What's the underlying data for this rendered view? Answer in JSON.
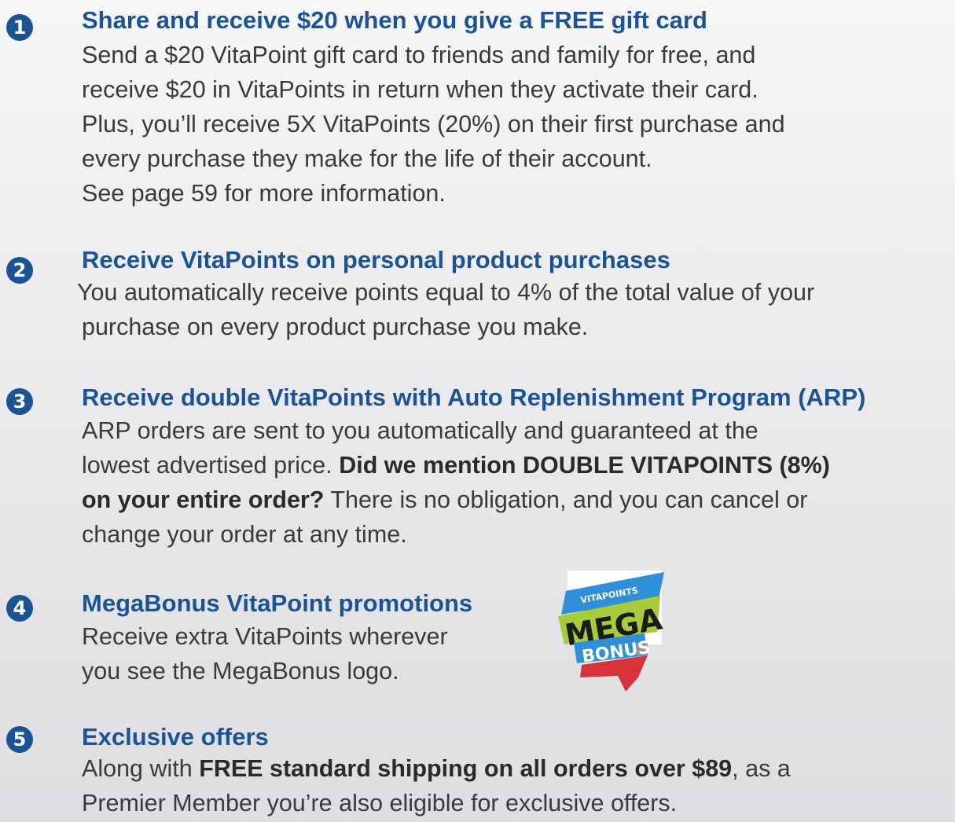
{
  "items": [
    {
      "number": "1",
      "title": "Share and receive $20 when you give a FREE gift card",
      "lines": [
        "Send a $20 VitaPoint gift card to friends and family for free, and",
        "receive $20 in VitaPoints in return when they activate their card.",
        "Plus, you’ll receive 5X VitaPoints (20%) on their first purchase and",
        "every purchase they make for the life of their account.",
        "See page 59 for more information."
      ]
    },
    {
      "number": "2",
      "title": "Receive VitaPoints on personal product purchases",
      "lines": [
        "You automatically receive points equal to 4% of the total value of your",
        "purchase on every product purchase you make."
      ]
    },
    {
      "number": "3",
      "title": "Receive double VitaPoints with Auto Replenishment Program (ARP)",
      "line1": "ARP orders are sent to you automatically and guaranteed at the",
      "line2_plain": "lowest advertised price. ",
      "line2_bold": "Did we mention DOUBLE VITAPOINTS (8%)",
      "line3_bold": "on your entire order?",
      "line3_plain": " There is no obligation, and you can cancel or",
      "line4": "change your order at any time."
    },
    {
      "number": "4",
      "title": "MegaBonus VitaPoint promotions",
      "lines": [
        "Receive extra VitaPoints wherever",
        "you see the MegaBonus logo."
      ],
      "logo": {
        "top_text": "VITAPOINTS",
        "mid_text": "MEGA",
        "bottom_text": "BONUS"
      }
    },
    {
      "number": "5",
      "title": "Exclusive offers",
      "line1_plain_a": "Along with ",
      "line1_bold": "FREE standard shipping on all orders over $89",
      "line1_plain_b": ", as a",
      "line2": "Premier Member you’re also eligible for exclusive offers."
    }
  ],
  "colors": {
    "accent": "#1b5395",
    "text": "#3a3a3c",
    "badge_blue": "#2f8fd8",
    "badge_green": "#a6cc3c",
    "badge_red": "#d8333b"
  }
}
